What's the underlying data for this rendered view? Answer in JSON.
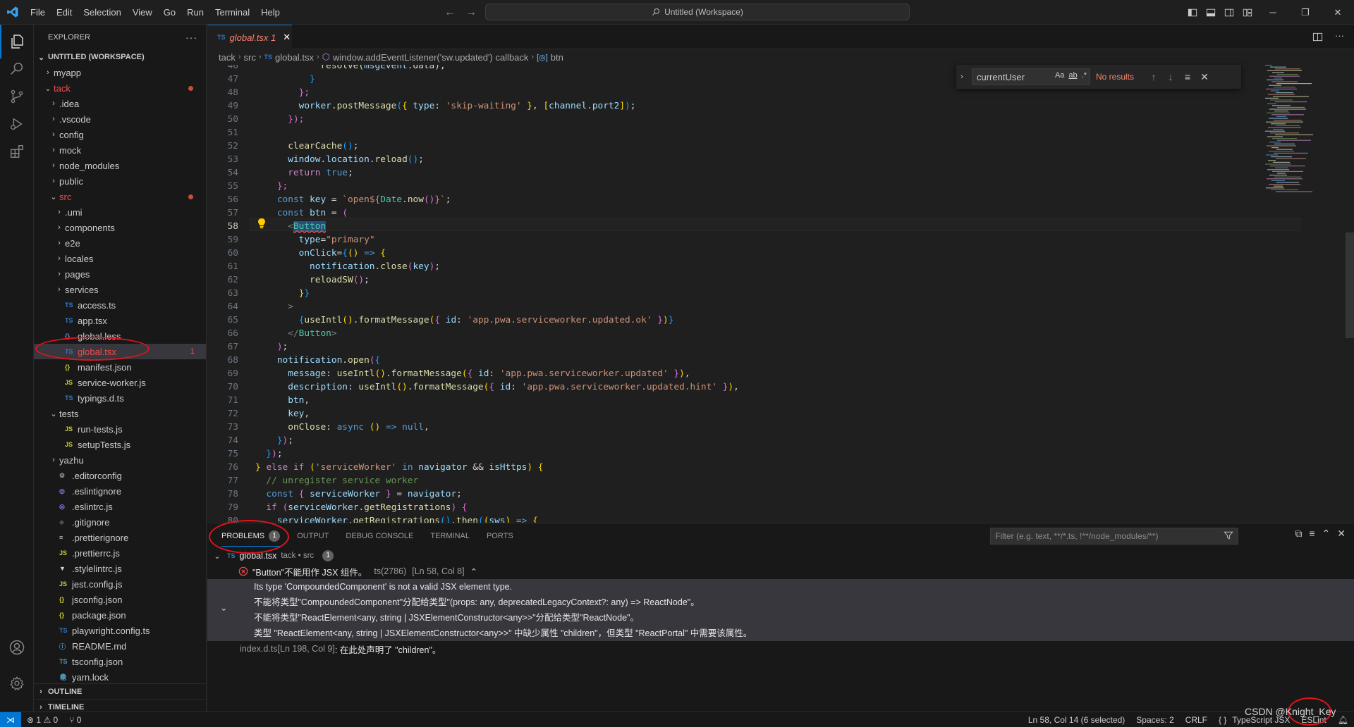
{
  "menu": [
    "File",
    "Edit",
    "Selection",
    "View",
    "Go",
    "Run",
    "Terminal",
    "Help"
  ],
  "search": {
    "text": "Untitled (Workspace)"
  },
  "explorer": {
    "title": "EXPLORER",
    "workspace": "UNTITLED (WORKSPACE)",
    "items": [
      {
        "label": "myapp",
        "type": "folder"
      },
      {
        "label": "tack",
        "type": "folder-open",
        "status": "error-dot"
      },
      {
        "label": ".idea",
        "type": "folder"
      },
      {
        "label": ".vscode",
        "type": "folder"
      },
      {
        "label": "config",
        "type": "folder"
      },
      {
        "label": "mock",
        "type": "folder"
      },
      {
        "label": "node_modules",
        "type": "folder"
      },
      {
        "label": "public",
        "type": "folder"
      },
      {
        "label": "src",
        "type": "folder-open",
        "status": "error-dot"
      },
      {
        "label": ".umi",
        "type": "folder"
      },
      {
        "label": "components",
        "type": "folder"
      },
      {
        "label": "e2e",
        "type": "folder"
      },
      {
        "label": "locales",
        "type": "folder"
      },
      {
        "label": "pages",
        "type": "folder"
      },
      {
        "label": "services",
        "type": "folder"
      },
      {
        "label": "access.ts",
        "type": "ts"
      },
      {
        "label": "app.tsx",
        "type": "ts"
      },
      {
        "label": "global.less",
        "type": "less"
      },
      {
        "label": "global.tsx",
        "type": "ts",
        "status": "error",
        "count": "1"
      },
      {
        "label": "manifest.json",
        "type": "json"
      },
      {
        "label": "service-worker.js",
        "type": "js"
      },
      {
        "label": "typings.d.ts",
        "type": "ts"
      },
      {
        "label": "tests",
        "type": "folder-open"
      },
      {
        "label": "run-tests.js",
        "type": "js"
      },
      {
        "label": "setupTests.js",
        "type": "js"
      },
      {
        "label": "yazhu",
        "type": "folder"
      },
      {
        "label": ".editorconfig",
        "type": "gear"
      },
      {
        "label": ".eslintignore",
        "type": "eslint"
      },
      {
        "label": ".eslintrc.js",
        "type": "eslint"
      },
      {
        "label": ".gitignore",
        "type": "git"
      },
      {
        "label": ".prettierignore",
        "type": "plain"
      },
      {
        "label": ".prettierrc.js",
        "type": "js"
      },
      {
        "label": ".stylelintrc.js",
        "type": "stylelint"
      },
      {
        "label": "jest.config.js",
        "type": "js"
      },
      {
        "label": "jsconfig.json",
        "type": "json"
      },
      {
        "label": "package.json",
        "type": "json"
      },
      {
        "label": "playwright.config.ts",
        "type": "ts"
      },
      {
        "label": "README.md",
        "type": "info"
      },
      {
        "label": "tsconfig.json",
        "type": "tsjson"
      },
      {
        "label": "yarn.lock",
        "type": "yarn"
      }
    ],
    "outline": "OUTLINE",
    "timeline": "TIMELINE"
  },
  "tab": {
    "label": "global.tsx",
    "suffix": "1",
    "lang": "TS"
  },
  "breadcrumb": {
    "parts": [
      "tack",
      "src",
      "global.tsx",
      "window.addEventListener('sw.updated') callback",
      "btn"
    ]
  },
  "editor": {
    "active_line": "58",
    "lines": [
      "46",
      "47",
      "48",
      "49",
      "50",
      "51",
      "52",
      "53",
      "54",
      "55",
      "56",
      "57",
      "58",
      "59",
      "60",
      "61",
      "62",
      "63",
      "64",
      "65",
      "66",
      "67",
      "68",
      "69",
      "70",
      "71",
      "72",
      "73",
      "74",
      "75",
      "76",
      "77",
      "78",
      "79",
      "80"
    ],
    "code": {
      "l46a": "resolve(",
      "l46b": "msgEvent",
      "l46c": ".data);",
      "l47": "}",
      "l48": "};",
      "l49a": "worker",
      "l49b": ".postMessage",
      "l49c": "type",
      "l49d": "'skip-waiting'",
      "l49e": "channel",
      "l49f": "port2",
      "l50": "});",
      "l52a": "clearCache",
      "l53a": "window",
      "l53b": "location",
      "l53c": "reload",
      "l54a": "return",
      "l54b": "true",
      "l55": "};",
      "l56a": "const",
      "l56b": "key",
      "l56c": "`open${",
      "l56d": "Date",
      "l56e": "now",
      "l56f": "}`",
      "l57a": "const",
      "l57b": "btn",
      "l58a": "Button",
      "l59a": "type",
      "l59b": "\"primary\"",
      "l60a": "onClick",
      "l61a": "notification",
      "l61b": "close",
      "l61c": "key",
      "l62a": "reloadSW",
      "l65a": "useIntl",
      "l65b": "formatMessage",
      "l65c": "id",
      "l65d": "'app.pwa.serviceworker.updated.ok'",
      "l66a": "Button",
      "l68a": "notification",
      "l68b": "open",
      "l69a": "message",
      "l69b": "useIntl",
      "l69c": "formatMessage",
      "l69d": "id",
      "l69e": "'app.pwa.serviceworker.updated'",
      "l70a": "description",
      "l70b": "useIntl",
      "l70c": "formatMessage",
      "l70d": "id",
      "l70e": "'app.pwa.serviceworker.updated.hint'",
      "l71": "btn",
      "l72": "key",
      "l73a": "onClose",
      "l73b": "async",
      "l73c": "null",
      "l76a": "else if",
      "l76b": "'serviceWorker'",
      "l76c": "in",
      "l76d": "navigator",
      "l76e": "isHttps",
      "l77": "// unregister service worker",
      "l78a": "const",
      "l78b": "serviceWorker",
      "l78c": "navigator",
      "l79a": "if",
      "l79b": "serviceWorker",
      "l79c": "getRegistrations",
      "l80a": "serviceWorker",
      "l80b": "getRegistrations",
      "l80c": "then",
      "l80d": "sws"
    }
  },
  "find": {
    "query": "currentUser",
    "result": "No results",
    "opt_case": "Aa",
    "opt_word": "ab",
    "opt_regex": ".*"
  },
  "panel": {
    "tabs": [
      "PROBLEMS",
      "OUTPUT",
      "DEBUG CONSOLE",
      "TERMINAL",
      "PORTS"
    ],
    "problems_count": "1",
    "filter_placeholder": "Filter (e.g. text, **/*.ts, !**/node_modules/**)",
    "file": "global.tsx",
    "file_path": "tack • src",
    "file_count": "1",
    "error_main": "\"Button\"不能用作 JSX 组件。",
    "error_code": "ts(2786)",
    "error_pos": "[Ln 58, Col 8]",
    "details": [
      "Its type 'CompoundedComponent' is not a valid JSX element type.",
      "不能将类型\"CompoundedComponent\"分配给类型\"(props: any, deprecatedLegacyContext?: any) => ReactNode\"。",
      "不能将类型\"ReactElement<any, string | JSXElementConstructor<any>>\"分配给类型\"ReactNode\"。",
      "类型 \"ReactElement<any, string | JSXElementConstructor<any>>\" 中缺少属性 \"children\"，但类型 \"ReactPortal\" 中需要该属性。"
    ],
    "related_file": "index.d.ts",
    "related_pos": "[Ln 198, Col 9]",
    "related_msg": ": 在此处声明了 \"children\"。"
  },
  "status": {
    "errors": "1",
    "warnings": "0",
    "ports": "0",
    "position": "Ln 58, Col 14 (6 selected)",
    "spaces": "Spaces: 2",
    "eol": "CRLF",
    "braces": "{ }",
    "language": "TypeScript JSX",
    "eslint": "ESLint"
  },
  "watermark": "CSDN @Knight_Key",
  "colors": {
    "accent": "#0078d4",
    "error": "#f14c4c",
    "modified": "#e2c08d",
    "annotation": "#e0141e"
  }
}
